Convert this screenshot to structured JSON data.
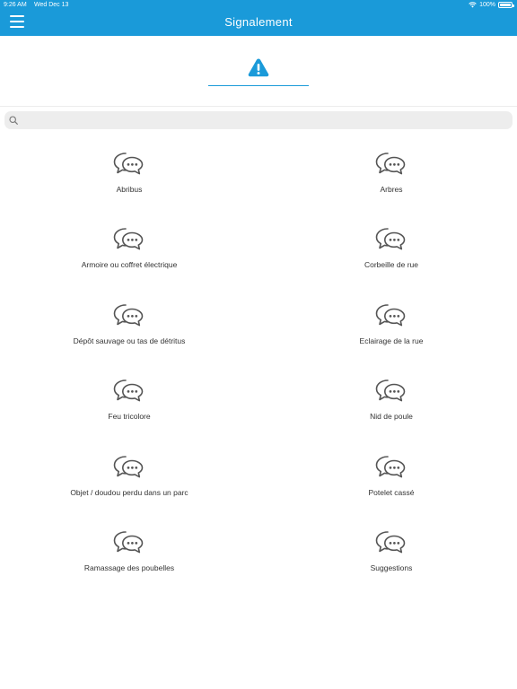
{
  "status_bar": {
    "time": "9:26 AM",
    "date": "Wed Dec 13",
    "battery": "100%"
  },
  "header": {
    "title": "Signalement"
  },
  "search": {
    "placeholder": "",
    "value": ""
  },
  "colors": {
    "accent": "#1a9ad9",
    "icon_stroke": "#555555"
  },
  "categories": [
    {
      "label": "Abribus",
      "icon": "chat-bubbles-icon"
    },
    {
      "label": "Arbres",
      "icon": "chat-bubbles-icon"
    },
    {
      "label": "Armoire ou coffret électrique",
      "icon": "chat-bubbles-icon"
    },
    {
      "label": "Corbeille de rue",
      "icon": "chat-bubbles-icon"
    },
    {
      "label": "Dépôt sauvage ou tas de détritus",
      "icon": "chat-bubbles-icon"
    },
    {
      "label": "Eclairage de la rue",
      "icon": "chat-bubbles-icon"
    },
    {
      "label": "Feu tricolore",
      "icon": "chat-bubbles-icon"
    },
    {
      "label": "Nid de poule",
      "icon": "chat-bubbles-icon"
    },
    {
      "label": "Objet / doudou perdu dans un parc",
      "icon": "chat-bubbles-icon"
    },
    {
      "label": "Potelet cassé",
      "icon": "chat-bubbles-icon"
    },
    {
      "label": "Ramassage des poubelles",
      "icon": "chat-bubbles-icon"
    },
    {
      "label": "Suggestions",
      "icon": "chat-bubbles-icon"
    }
  ]
}
